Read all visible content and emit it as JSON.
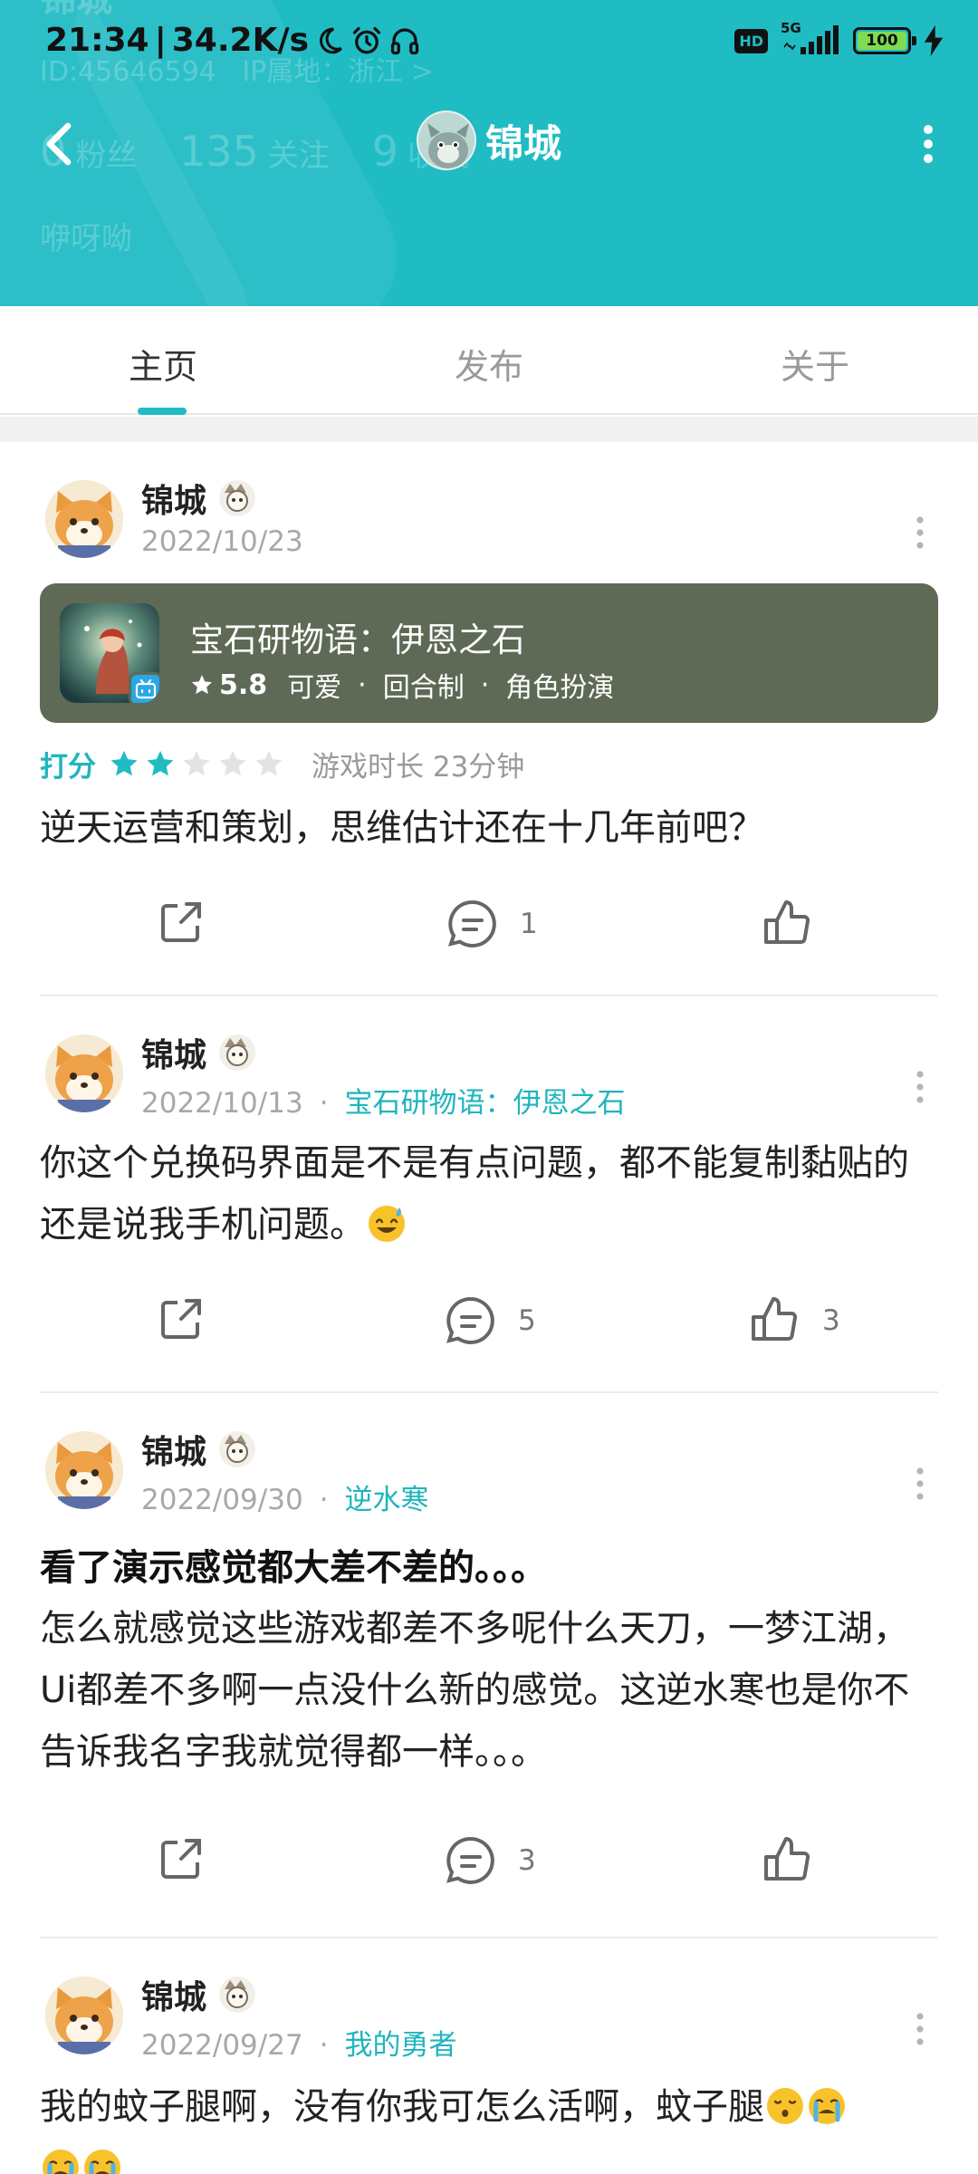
{
  "status_bar": {
    "time": "21:34",
    "speed": "34.2K/s",
    "hd": "HD",
    "network": "5G",
    "battery": "100"
  },
  "header_bg": {
    "name": "锦城",
    "id": "ID:45646594",
    "ip": "IP属地：浙江 >",
    "fans_count": "0",
    "fans_label": "粉丝",
    "follow_count": "135",
    "follow_label": "关注",
    "fav_count": "9",
    "fav_label": "收藏",
    "bio": "咿呀呦"
  },
  "nav": {
    "title": "锦城"
  },
  "tabs": [
    {
      "label": "主页",
      "active": true
    },
    {
      "label": "发布",
      "active": false
    },
    {
      "label": "关于",
      "active": false
    }
  ],
  "posts": [
    {
      "author": "锦城",
      "date": "2022/10/23",
      "game_card": {
        "name": "宝石研物语：伊恩之石",
        "score": "5.8",
        "tags": [
          "可爱",
          "回合制",
          "角色扮演"
        ]
      },
      "rating_label": "打分",
      "rating": 2,
      "play_time": "游戏时长 23分钟",
      "body": "逆天运营和策划，思维估计还在十几年前吧？",
      "comments": "1",
      "likes": ""
    },
    {
      "author": "锦城",
      "date": "2022/10/13",
      "game": "宝石研物语：伊恩之石",
      "body": "你这个兑换码界面是不是有点问题，都不能复制黏贴的还是说我手机问题。",
      "comments": "5",
      "likes": "3"
    },
    {
      "author": "锦城",
      "date": "2022/09/30",
      "game": "逆水寒",
      "title": "看了演示感觉都大差不差的。。。",
      "body": "怎么就感觉这些游戏都差不多呢什么天刀，一梦江湖，Ui都差不多啊一点没什么新的感觉。这逆水寒也是你不告诉我名字我就觉得都一样。。。",
      "comments": "3",
      "likes": ""
    },
    {
      "author": "锦城",
      "date": "2022/09/27",
      "game": "我的勇者",
      "body": "我的蚊子腿啊，没有你我可怎么活啊，蚊子腿"
    }
  ],
  "colors": {
    "accent": "#1fbcc4",
    "card_bg": "#5e6a55"
  }
}
